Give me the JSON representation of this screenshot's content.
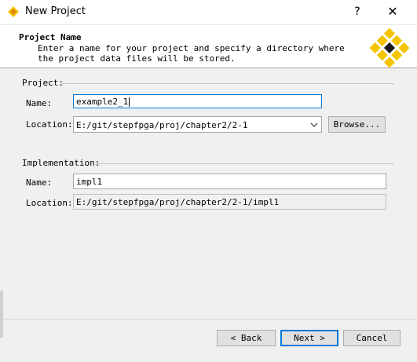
{
  "window": {
    "title": "New Project",
    "help_glyph": "?",
    "close_glyph": "✕"
  },
  "header": {
    "title": "Project Name",
    "description": "Enter a name for your project and specify a directory where the project data files will be stored."
  },
  "project": {
    "section_label": "Project:",
    "name_label": "Name:",
    "name_value": "example2_1",
    "location_label": "Location:",
    "location_value": "E:/git/stepfpga/proj/chapter2/2-1",
    "browse_label": "Browse..."
  },
  "implementation": {
    "section_label": "Implementation:",
    "name_label": "Name:",
    "name_value": "impl1",
    "location_label": "Location:",
    "location_value": "E:/git/stepfpga/proj/chapter2/2-1/impl1"
  },
  "footer": {
    "back_label": "< Back",
    "next_label": "Next >",
    "cancel_label": "Cancel"
  },
  "colors": {
    "accent": "#0078d7",
    "logo_yellow": "#f5c400",
    "logo_dark": "#1a1a1a"
  }
}
